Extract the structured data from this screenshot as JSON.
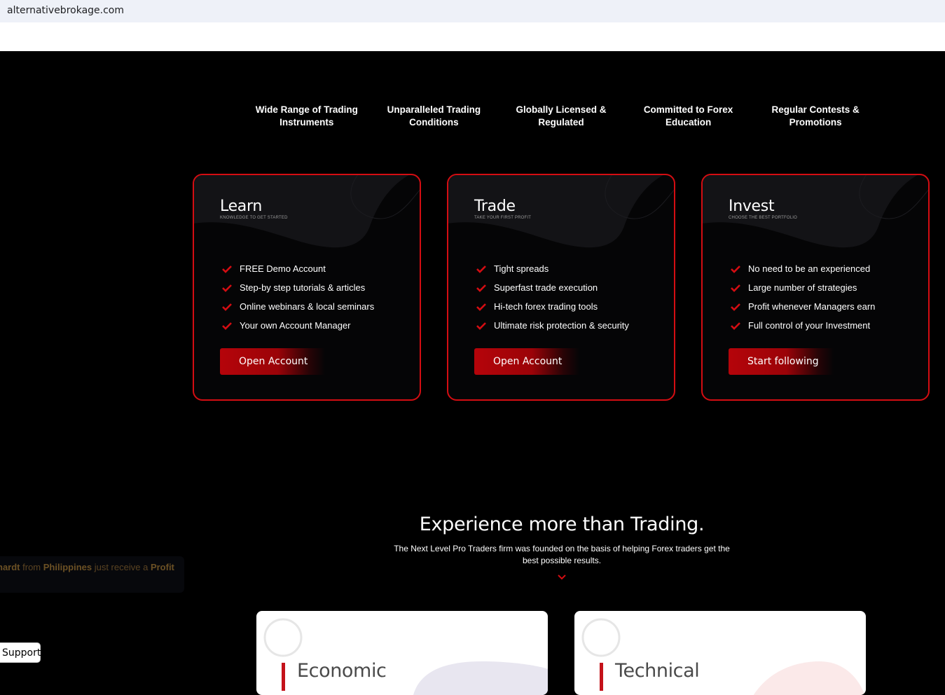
{
  "browser": {
    "url": "alternativebrokage.com"
  },
  "features": [
    "Wide Range of Trading Instruments",
    "Unparalleled Trading Conditions",
    "Globally Licensed & Regulated",
    "Committed to Forex Education",
    "Regular Contests & Promotions"
  ],
  "cards": [
    {
      "title": "Learn",
      "subtitle": "KNOWLEDGE TO GET STARTED",
      "items": [
        "FREE Demo Account",
        "Step-by step tutorials & articles",
        "Online webinars & local seminars",
        "Your own Account Manager"
      ],
      "button": "Open Account"
    },
    {
      "title": "Trade",
      "subtitle": "TAKE YOUR FIRST PROFIT",
      "items": [
        "Tight spreads",
        "Superfast trade execution",
        "Hi-tech forex trading tools",
        "Ultimate risk protection & security"
      ],
      "button": "Open Account"
    },
    {
      "title": "Invest",
      "subtitle": "CHOOSE THE BEST PORTFOLIO",
      "items": [
        "No need to be an experienced",
        "Large number of strategies",
        "Profit whenever Managers earn",
        "Full control of your Investment"
      ],
      "button": "Start following"
    }
  ],
  "experience": {
    "title": "Experience more than Trading.",
    "subtitle": "The Next Level Pro Traders firm was founded on the basis of helping Forex traders get the best possible results."
  },
  "toast": {
    "name": "hardt",
    "from": "from",
    "country": "Philippines",
    "action": "just receive a",
    "profit": "Profit"
  },
  "support": {
    "label": "Support"
  },
  "panels": [
    {
      "title": "Economic"
    },
    {
      "title": "Technical"
    }
  ],
  "colors": {
    "accent": "#d40d12",
    "background": "#000000",
    "button": "#b5040a"
  }
}
